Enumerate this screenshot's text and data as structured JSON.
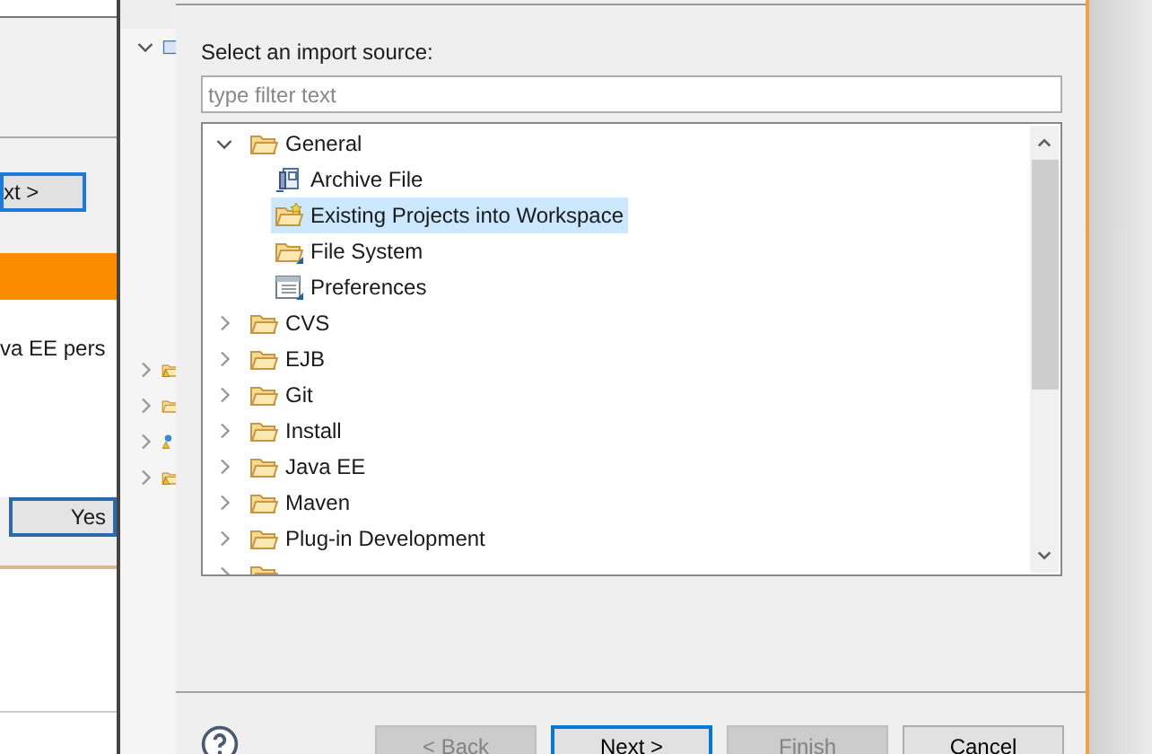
{
  "background_dialog": {
    "next_button": "xt >",
    "message": "va EE pers",
    "yes_button": "Yes"
  },
  "explorer_strip": {
    "rows": [
      {
        "expanded": true,
        "kind": "project"
      },
      {
        "expanded": false,
        "kind": "warning"
      },
      {
        "expanded": false,
        "kind": "folder"
      },
      {
        "expanded": false,
        "kind": "globe"
      },
      {
        "expanded": false,
        "kind": "warning"
      }
    ]
  },
  "dialog": {
    "prompt": "Select an import source:",
    "filter": {
      "placeholder": "type filter text"
    },
    "tree": [
      {
        "label": "General",
        "kind": "folder",
        "expanded": true,
        "selected": false,
        "children": [
          {
            "label": "Archive File",
            "kind": "archive",
            "selected": false
          },
          {
            "label": "Existing Projects into Workspace",
            "kind": "projects",
            "selected": true
          },
          {
            "label": "File System",
            "kind": "filesystem",
            "selected": false
          },
          {
            "label": "Preferences",
            "kind": "preferences",
            "selected": false
          }
        ]
      },
      {
        "label": "CVS",
        "kind": "folder",
        "expanded": false,
        "selected": false
      },
      {
        "label": "EJB",
        "kind": "folder",
        "expanded": false,
        "selected": false
      },
      {
        "label": "Git",
        "kind": "folder",
        "expanded": false,
        "selected": false
      },
      {
        "label": "Install",
        "kind": "folder",
        "expanded": false,
        "selected": false
      },
      {
        "label": "Java EE",
        "kind": "folder",
        "expanded": false,
        "selected": false
      },
      {
        "label": "Maven",
        "kind": "folder",
        "expanded": false,
        "selected": false
      },
      {
        "label": "Plug-in Development",
        "kind": "folder",
        "expanded": false,
        "selected": false
      }
    ],
    "buttons": [
      {
        "label": "< Back",
        "disabled": true,
        "default": false
      },
      {
        "label": "Next >",
        "disabled": false,
        "default": true
      },
      {
        "label": "Finish",
        "disabled": true,
        "default": false
      },
      {
        "label": "Cancel",
        "disabled": false,
        "default": false
      }
    ]
  }
}
